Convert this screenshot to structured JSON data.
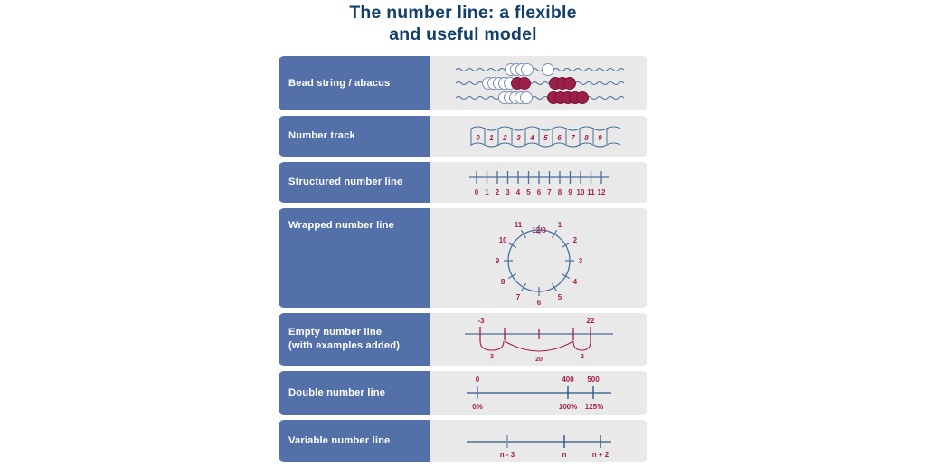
{
  "title": {
    "line1": "The number line: a flexible",
    "line2": "and useful model",
    "color": "#12406b"
  },
  "theme": {
    "label_bg": "#5470a8",
    "panel_bg": "#e9e9e9",
    "accent_red": "#a52050",
    "bead_red": "#9c1f4a",
    "line_blue": "#4a6f9c",
    "label_text": "#ffffff"
  },
  "rows": [
    {
      "label": "Bead string / abacus",
      "figure": "bead-string",
      "strings": [
        {
          "white": 4,
          "red": 0,
          "white2": 1,
          "red2": 0
        },
        {
          "white": 5,
          "red": 2,
          "white2": 0,
          "red2": 3
        },
        {
          "white": 5,
          "red": 0,
          "white2": 0,
          "red2": 5
        }
      ]
    },
    {
      "label": "Number track",
      "figure": "number-track",
      "cells": [
        "0",
        "1",
        "2",
        "3",
        "4",
        "5",
        "6",
        "7",
        "8",
        "9"
      ]
    },
    {
      "label": "Structured number line",
      "figure": "structured-number-line",
      "ticks": [
        "0",
        "1",
        "2",
        "3",
        "4",
        "5",
        "6",
        "7",
        "8",
        "9",
        "10",
        "11",
        "12"
      ]
    },
    {
      "label": "Wrapped number line",
      "figure": "wrapped-number-line",
      "top_label": "12/0",
      "hours": [
        "1",
        "2",
        "3",
        "4",
        "5",
        "6",
        "7",
        "8",
        "9",
        "10",
        "11"
      ]
    },
    {
      "label_line1": "Empty number line",
      "label_line2": "(with examples added)",
      "figure": "empty-number-line",
      "start_label": "-3",
      "end_label": "22",
      "jumps": [
        "3",
        "20",
        "2"
      ]
    },
    {
      "label": "Double number line",
      "figure": "double-number-line",
      "top": [
        "0",
        "400",
        "500"
      ],
      "bottom": [
        "0%",
        "100%",
        "125%"
      ]
    },
    {
      "label": "Variable number line",
      "figure": "variable-number-line",
      "ticks": [
        "n - 3",
        "n",
        "n + 2"
      ]
    }
  ]
}
